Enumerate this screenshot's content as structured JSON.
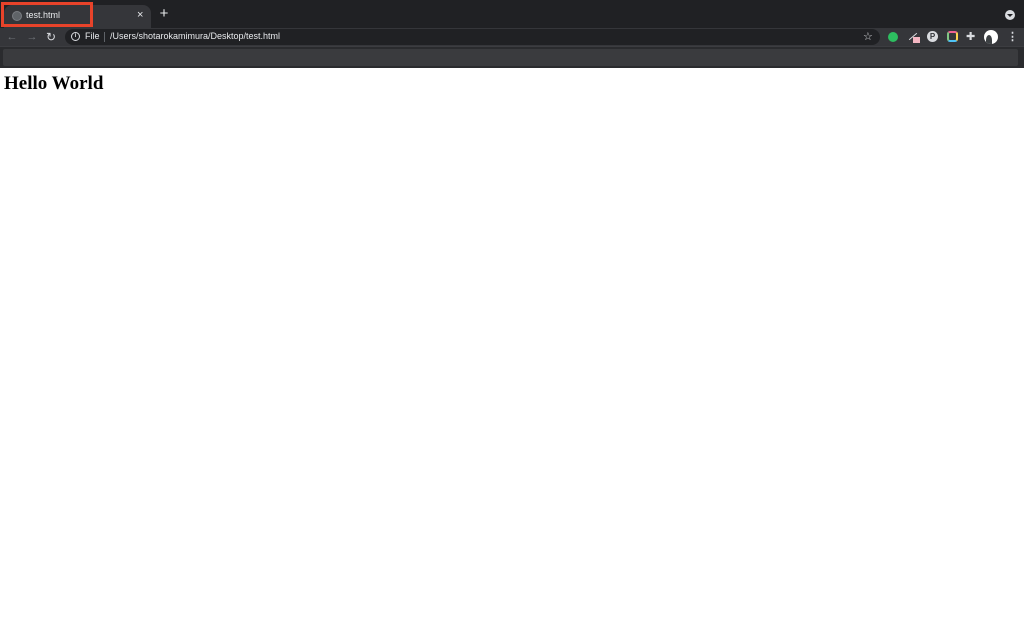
{
  "browser": {
    "tab": {
      "title": "test.html",
      "close_glyph": "×"
    },
    "new_tab_glyph": "+",
    "toolbar": {
      "back_glyph": "←",
      "forward_glyph": "→",
      "reload_glyph": "↻",
      "scheme_label": "File",
      "url": "/Users/shotarokamimura/Desktop/test.html",
      "star_glyph": "☆",
      "menu_glyph": "⋮"
    },
    "extensions": [
      "evernote-icon",
      "pen-icon",
      "pinterest-icon",
      "colorpicker-icon",
      "puzzle-icon"
    ],
    "accent_highlight_color": "#e8432a"
  },
  "page": {
    "heading": "Hello World"
  }
}
